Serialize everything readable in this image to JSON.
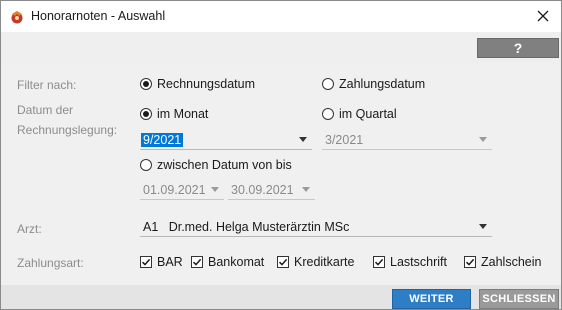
{
  "window": {
    "title": "Honorarnoten - Auswahl",
    "close_icon": "close-icon",
    "app_icon": "app-logo-icon"
  },
  "help_button": {
    "label": "?"
  },
  "filter": {
    "label": "Filter nach:",
    "options": [
      "Rechnungsdatum",
      "Zahlungsdatum"
    ],
    "selected": "Rechnungsdatum"
  },
  "datum": {
    "label_line1": "Datum der",
    "label_line2": "Rechnungslegung:",
    "im_monat": {
      "label": "im Monat",
      "checked": true,
      "value": "9/2021"
    },
    "im_quartal": {
      "label": "im Quartal",
      "checked": false,
      "value": "3/2021"
    },
    "zwischen": {
      "label": "zwischen Datum von bis",
      "checked": false,
      "from": "01.09.2021",
      "to": "30.09.2021"
    }
  },
  "arzt": {
    "label": "Arzt:",
    "value": "A1   Dr.med. Helga Musterärztin MSc"
  },
  "zahlungsart": {
    "label": "Zahlungsart:",
    "options": [
      {
        "label": "BAR",
        "checked": true
      },
      {
        "label": "Bankomat",
        "checked": true
      },
      {
        "label": "Kreditkarte",
        "checked": true
      },
      {
        "label": "Lastschrift",
        "checked": true
      },
      {
        "label": "Zahlschein",
        "checked": true
      }
    ]
  },
  "buttons": {
    "weiter": "WEITER",
    "schliessen": "SCHLIESSEN"
  },
  "colors": {
    "primary_button": "#2d7ec4",
    "secondary_button": "#9a9a9a",
    "help_button": "#808080",
    "selection": "#0078d7"
  }
}
